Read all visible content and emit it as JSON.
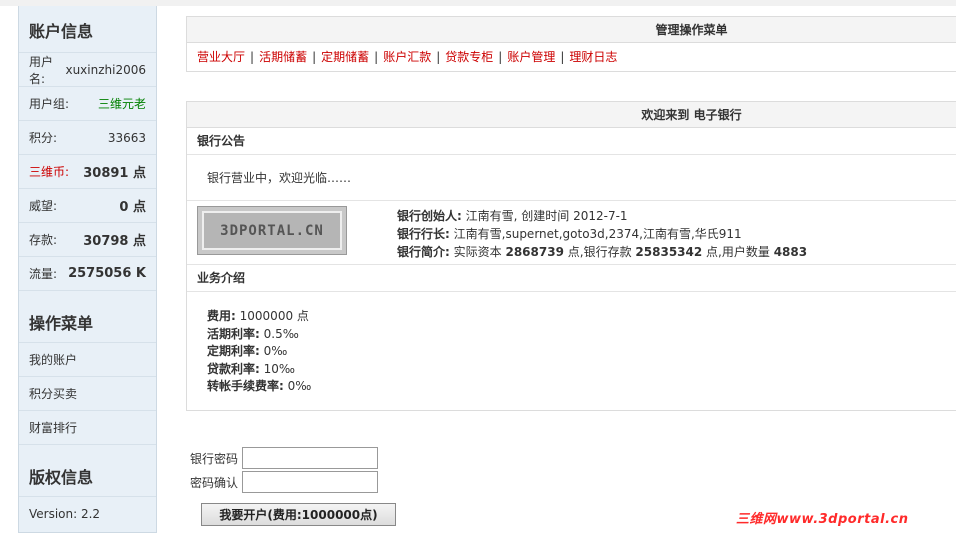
{
  "sidebar": {
    "account_title": "账户信息",
    "rows": [
      {
        "label": "用户名:",
        "value": "xuxinzhi2006"
      },
      {
        "label": "用户组:",
        "value": "三维元老"
      },
      {
        "label": "积分:",
        "value": "33663"
      },
      {
        "label": "三维币:",
        "value": "30891 点"
      },
      {
        "label": "威望:",
        "value": "0 点"
      },
      {
        "label": "存款:",
        "value": "30798 点"
      },
      {
        "label": "流量:",
        "value": "2575056 K"
      }
    ],
    "menu_title": "操作菜单",
    "menu_items": [
      "我的账户",
      "积分买卖",
      "财富排行"
    ],
    "copyright_title": "版权信息",
    "version": "Version: 2.2"
  },
  "main_menu": {
    "title": "管理操作菜单",
    "links": [
      "营业大厅",
      "活期储蓄",
      "定期储蓄",
      "账户汇款",
      "贷款专柜",
      "账户管理",
      "理财日志"
    ]
  },
  "bank": {
    "welcome_title": "欢迎来到 电子银行",
    "notice_title": "银行公告",
    "notice_text": "银行营业中，欢迎光临……",
    "logo_text": "3DPORTAL.CN",
    "founder_label": "银行创始人:",
    "founder_value": "江南有雪, 创建时间 2012-7-1",
    "president_label": "银行行长:",
    "president_value": "江南有雪,supernet,goto3d,2374,江南有雪,华氏911",
    "intro_label": "银行简介:",
    "intro_p1": "实际资本",
    "capital": "2868739",
    "intro_p2": "点,银行存款",
    "deposits": "25835342",
    "intro_p3": "点,用户数量",
    "users": "4883",
    "biz_title": "业务介绍",
    "fee_label": "费用:",
    "fee_value": "1000000 点",
    "current_rate_label": "活期利率:",
    "current_rate_value": "0.5‰",
    "fixed_rate_label": "定期利率:",
    "fixed_rate_value": "0‰",
    "loan_rate_label": "贷款利率:",
    "loan_rate_value": "10‰",
    "transfer_fee_label": "转帐手续费率:",
    "transfer_fee_value": "0‰"
  },
  "form": {
    "password_label": "银行密码",
    "confirm_label": "密码确认",
    "submit_label": "我要开户(费用:1000000点)"
  },
  "watermark": "三维网www.3dportal.cn",
  "colors": {
    "link_red": "#cc0000",
    "group_green": "#008000",
    "sidebar_bg": "#e8f0f7"
  }
}
